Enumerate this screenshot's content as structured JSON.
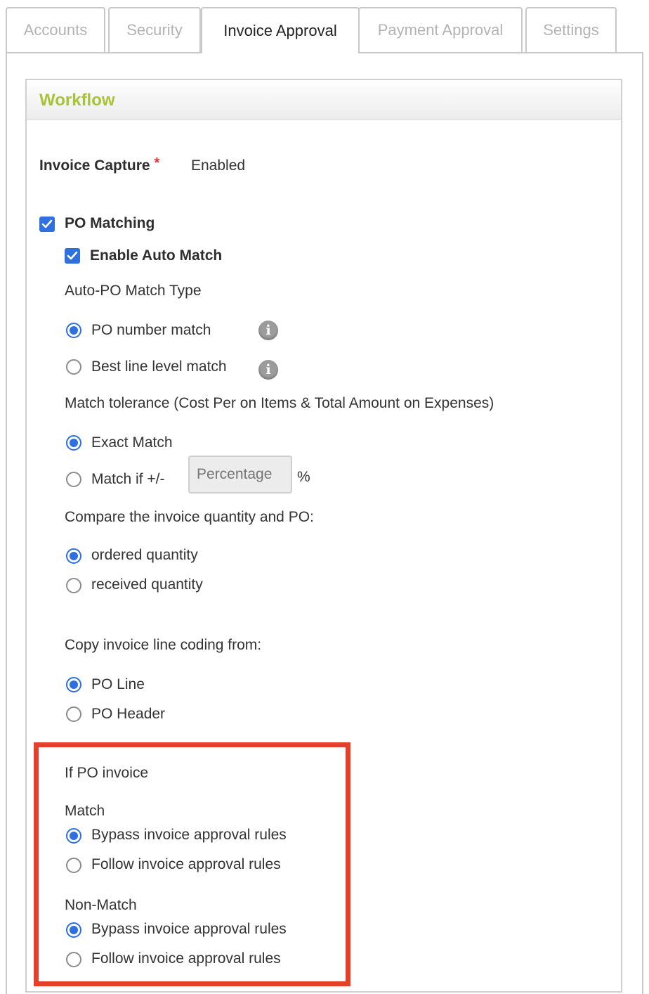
{
  "tabs": [
    {
      "label": "Accounts",
      "active": false
    },
    {
      "label": "Security",
      "active": false
    },
    {
      "label": "Invoice Approval",
      "active": true
    },
    {
      "label": "Payment Approval",
      "active": false
    },
    {
      "label": "Settings",
      "active": false
    }
  ],
  "workflow": {
    "title": "Workflow",
    "invoice_capture": {
      "label": "Invoice Capture",
      "required_marker": "*",
      "value": "Enabled"
    },
    "po_matching": {
      "label": "PO Matching",
      "checked": true
    },
    "auto_match": {
      "label": "Enable Auto Match",
      "checked": true
    },
    "auto_po_match_type": {
      "label": "Auto-PO Match Type",
      "options": [
        {
          "label": "PO number match",
          "selected": true
        },
        {
          "label": "Best line level match",
          "selected": false
        }
      ]
    },
    "match_tolerance": {
      "label": "Match tolerance (Cost Per on Items & Total Amount on Expenses)",
      "options": [
        {
          "label": "Exact Match",
          "selected": true
        },
        {
          "label": "Match if +/-",
          "selected": false
        }
      ],
      "percentage_placeholder": "Percentage",
      "percent_sign": "%"
    },
    "compare_quantity": {
      "label": "Compare the invoice quantity and PO:",
      "options": [
        {
          "label": "ordered quantity",
          "selected": true
        },
        {
          "label": "received quantity",
          "selected": false
        }
      ]
    },
    "copy_coding": {
      "label": "Copy invoice line coding from:",
      "options": [
        {
          "label": "PO Line",
          "selected": true
        },
        {
          "label": "PO Header",
          "selected": false
        }
      ]
    },
    "if_po_invoice": {
      "label": "If PO invoice",
      "match": {
        "label": "Match",
        "options": [
          {
            "label": "Bypass invoice approval rules",
            "selected": true
          },
          {
            "label": "Follow invoice approval rules",
            "selected": false
          }
        ]
      },
      "non_match": {
        "label": "Non-Match",
        "options": [
          {
            "label": "Bypass invoice approval rules",
            "selected": true
          },
          {
            "label": "Follow invoice approval rules",
            "selected": false
          }
        ]
      }
    }
  },
  "colors": {
    "accent": "#2f6fe0",
    "title": "#a7c33a",
    "highlight": "#e4402c",
    "required": "#e0322c"
  },
  "icons": {
    "info": "info-icon",
    "check": "checkmark-icon"
  }
}
